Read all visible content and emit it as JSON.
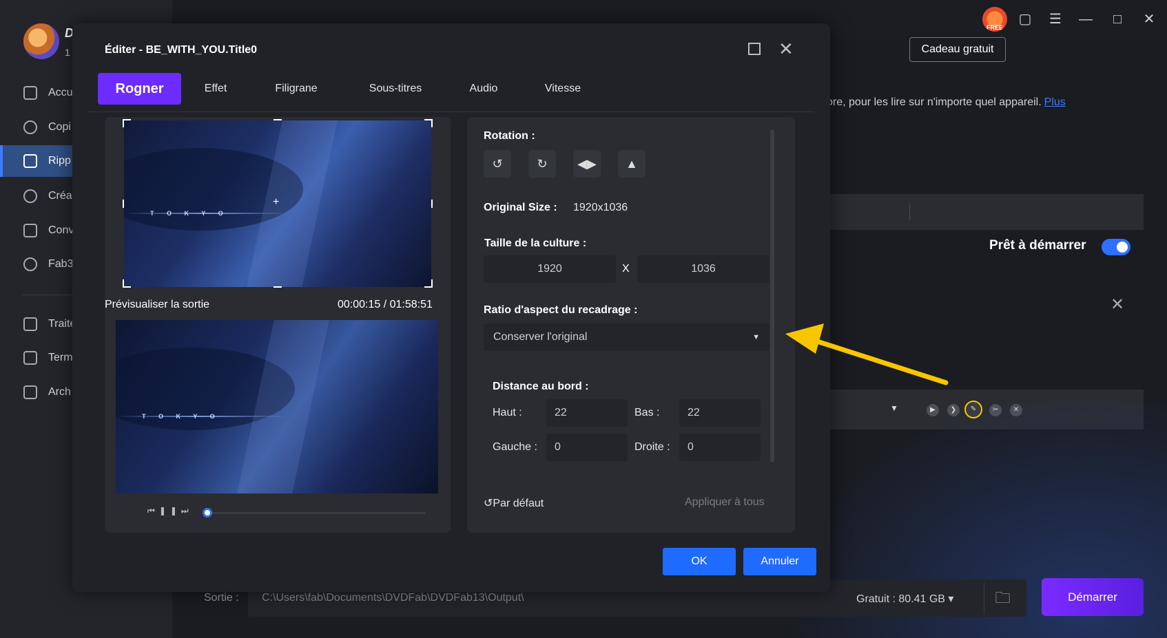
{
  "app": {
    "brand": "D",
    "brand_sub": "1",
    "free_badge": "FREE",
    "gift_button": "Cadeau gratuit",
    "description": "ore, pour les lire sur n'importe quel appareil.",
    "description_link": "Plus",
    "ready_label": "Prêt à démarrer",
    "sidebar": {
      "items": [
        {
          "label": "Accu",
          "icon": "home-icon"
        },
        {
          "label": "Copi",
          "icon": "copy-disc-icon"
        },
        {
          "label": "Ripp",
          "icon": "ripper-icon"
        },
        {
          "label": "Créa",
          "icon": "creator-disc-icon"
        },
        {
          "label": "Conv",
          "icon": "film-icon"
        },
        {
          "label": "Fab3",
          "icon": "globe-icon"
        },
        {
          "label": "Traite",
          "icon": "task-list-icon"
        },
        {
          "label": "Term",
          "icon": "clipboard-icon"
        },
        {
          "label": "Arch",
          "icon": "archive-icon"
        }
      ]
    },
    "bottom": {
      "output_label": "Sortie :",
      "output_path": "C:\\Users\\fab\\Documents\\DVDFab\\DVDFab13\\Output\\",
      "free_space": "Gratuit : 80.41 GB ▾",
      "start_button": "Démarrer"
    }
  },
  "dialog": {
    "title": "Éditer - BE_WITH_YOU.Title0",
    "tabs": [
      {
        "label": "Rogner",
        "active": true
      },
      {
        "label": "Effet"
      },
      {
        "label": "Filigrane"
      },
      {
        "label": "Sous-titres"
      },
      {
        "label": "Audio"
      },
      {
        "label": "Vitesse"
      }
    ],
    "video_text": "T O K Y O",
    "preview_label": "Prévisualiser la sortie",
    "timecode": "00:00:15 / 01:58:51",
    "rotation_label": "Rotation :",
    "original_size_label": "Original Size :",
    "original_size_value": "1920x1036",
    "crop_size_label": "Taille de la culture :",
    "crop_width": "1920",
    "crop_height": "1036",
    "x_sep": "X",
    "aspect_label": "Ratio d'aspect du recadrage :",
    "aspect_value": "Conserver l'original",
    "edge_label": "Distance au bord :",
    "top_label": "Haut :",
    "top_value": "22",
    "bottom_label": "Bas :",
    "bottom_value": "22",
    "left_label": "Gauche :",
    "left_value": "0",
    "right_label": "Droite :",
    "right_value": "0",
    "default_label": "Par défaut",
    "apply_all_label": "Appliquer à tous",
    "ok_label": "OK",
    "cancel_label": "Annuler"
  },
  "colors": {
    "accent_purple": "#6c2bff",
    "accent_blue": "#1f6bff",
    "annotation": "#f7c600"
  }
}
